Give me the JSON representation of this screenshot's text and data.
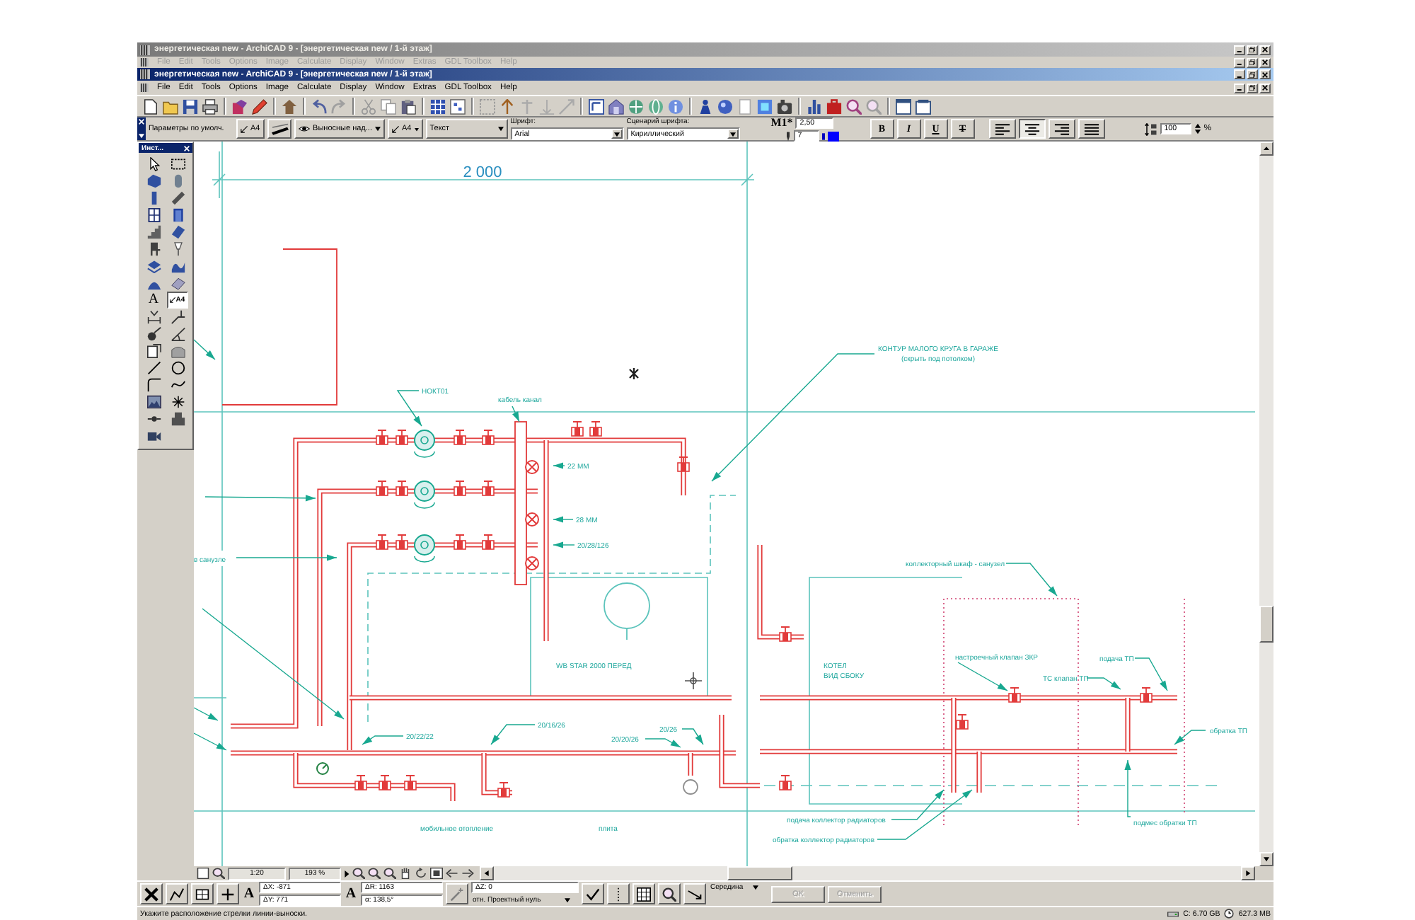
{
  "background_window": {
    "title": "энергетическая new - ArchiCAD 9 - [энергетическая new / 1-й этаж]",
    "menu": [
      "File",
      "Edit",
      "Tools",
      "Options",
      "Image",
      "Calculate",
      "Display",
      "Window",
      "Extras",
      "GDL Toolbox",
      "Help"
    ]
  },
  "window": {
    "title": "энергетическая new - ArchiCAD 9 - [энергетическая new / 1-й этаж]",
    "menu": [
      "File",
      "Edit",
      "Tools",
      "Options",
      "Image",
      "Calculate",
      "Display",
      "Window",
      "Extras",
      "GDL Toolbox",
      "Help"
    ]
  },
  "info_box": {
    "preset": "Параметры по умолч.",
    "label_button": "A4",
    "layer": "Выносные над...",
    "label_type": "A4",
    "text_type": "Текст",
    "font_label": "Шрифт:",
    "font": "Arial",
    "script_label": "Сценарий шрифта:",
    "script": "Кириллический",
    "size_label": "M1*",
    "text_size": "2,50",
    "pen": "7",
    "style_buttons": [
      {
        "label": "B",
        "kind": "bold",
        "selected": false
      },
      {
        "label": "I",
        "kind": "italic",
        "selected": false
      },
      {
        "label": "U",
        "kind": "underline",
        "selected": false
      },
      {
        "label": "T",
        "kind": "strike",
        "selected": false
      }
    ],
    "alignment": [
      {
        "kind": "left",
        "selected": false
      },
      {
        "kind": "center",
        "selected": true
      },
      {
        "kind": "right",
        "selected": false
      },
      {
        "kind": "justify",
        "selected": false
      }
    ],
    "line_spacing": "100",
    "unit": "%"
  },
  "toolbox": {
    "title": "Инст...",
    "tools": [
      {
        "selected": false
      },
      {
        "selected": false
      },
      {
        "selected": false
      },
      {
        "selected": false
      },
      {
        "selected": false
      },
      {
        "selected": false
      },
      {
        "selected": false
      },
      {
        "selected": false
      },
      {
        "selected": false
      },
      {
        "selected": false
      },
      {
        "selected": false
      },
      {
        "selected": false
      },
      {
        "selected": false
      },
      {
        "selected": false
      },
      {
        "selected": false
      },
      {
        "selected": false
      },
      {
        "selected": false,
        "text": "A"
      },
      {
        "selected": true,
        "text": "A4"
      },
      {
        "selected": false
      },
      {
        "selected": false
      },
      {
        "selected": false
      },
      {
        "selected": false
      },
      {
        "selected": false
      },
      {
        "selected": false
      },
      {
        "selected": false
      },
      {
        "selected": false
      },
      {
        "selected": false
      },
      {
        "selected": false
      },
      {
        "selected": false
      },
      {
        "selected": false
      },
      {
        "selected": false
      },
      {
        "selected": false
      },
      {
        "selected": false
      }
    ]
  },
  "drawing": {
    "dimension": "2 000",
    "labels": [
      "КОНТУР МАЛОГО КРУГА В ГАРАЖЕ",
      "(скрыть под потолком)",
      "НОКТ01",
      "кабель  канал",
      "22 ММ",
      "28 ММ",
      "20/28/126",
      "в санузле",
      "WB STAR 2000 ПЕРЕД",
      "20/22/22",
      "20/16/26",
      "20/20/26",
      "20/26",
      "мобильное отопление",
      "плита",
      "коллекторный шкаф - санузел",
      "КОТЕЛ",
      "ВИД СБОКУ",
      "настроечный клапан ЗКР",
      "ТС клапан ТП",
      "подача ТП",
      "обратка ТП",
      "подача коллектор радиаторов",
      "обратка коллектор радиаторов",
      "подмес обратки ТП"
    ]
  },
  "navigator": {
    "scale": "1:20",
    "zoom": "193 %"
  },
  "control_box": {
    "mode_a": "A",
    "fields_a": [
      "ΔX: -871",
      "ΔY: 771"
    ],
    "mode_b": "A",
    "fields_b": [
      "ΔR: 1163",
      "α: 138,5°"
    ],
    "elevation": "ΔZ: 0",
    "reference": "отн. Проектный нуль",
    "snap": "Середина",
    "buttons": [
      {
        "label": "OK",
        "disabled": true
      },
      {
        "label": "Отменить",
        "disabled": true
      }
    ]
  },
  "status_bar": {
    "message": "Укажите расположение стрелки линии-выноски.",
    "disk": "C: 6.70 GB",
    "memory": "627.3 MB"
  }
}
